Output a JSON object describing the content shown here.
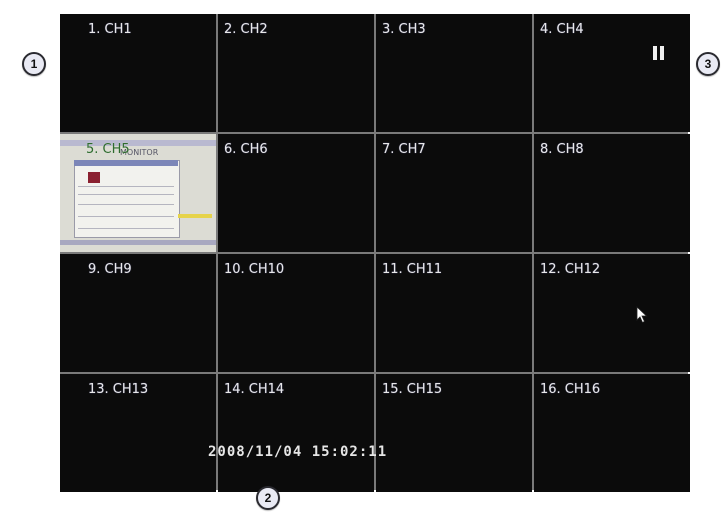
{
  "channels": [
    {
      "label": "1. CH1"
    },
    {
      "label": "2. CH2"
    },
    {
      "label": "3. CH3"
    },
    {
      "label": "4. CH4"
    },
    {
      "label": "5. CH5"
    },
    {
      "label": "6. CH6"
    },
    {
      "label": "7. CH7"
    },
    {
      "label": "8. CH8"
    },
    {
      "label": "9. CH9"
    },
    {
      "label": "10. CH10"
    },
    {
      "label": "11. CH11"
    },
    {
      "label": "12. CH12"
    },
    {
      "label": "13. CH13"
    },
    {
      "label": "14. CH14"
    },
    {
      "label": "15. CH15"
    },
    {
      "label": "16. CH16"
    }
  ],
  "preview": {
    "overlay_text": "MONITOR"
  },
  "status": {
    "datetime": "2008/11/04 15:02:11",
    "playback_state_icon": "pause-icon"
  },
  "pointer": {
    "icon": "mouse-cursor-icon"
  },
  "callouts": [
    "1",
    "2",
    "3"
  ],
  "colors": {
    "screen_background": "#0b0b0b",
    "grid_lines": "#7a7a7a",
    "channel_text": "#e8e8e8",
    "callout_fill": "#e9eaf4"
  }
}
